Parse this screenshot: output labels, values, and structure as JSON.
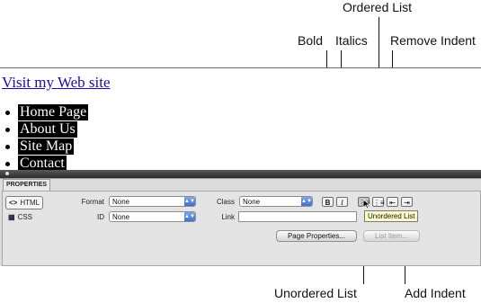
{
  "callouts": {
    "bold": "Bold",
    "italics": "Italics",
    "ordered_list": "Ordered List",
    "remove_indent": "Remove Indent",
    "unordered_list": "Unordered List",
    "add_indent": "Add Indent"
  },
  "page": {
    "link_text": "Visit my Web site",
    "nav_items": [
      "Home Page",
      "About Us",
      "Site Map",
      "Contact"
    ]
  },
  "panel": {
    "tab_label": "PROPERTIES",
    "modes": {
      "html": "HTML",
      "css": "CSS"
    },
    "format_label": "Format",
    "format_value": "None",
    "id_label": "ID",
    "id_value": "None",
    "class_label": "Class",
    "class_value": "None",
    "link_label": "Link",
    "link_value": "",
    "bold_glyph": "B",
    "italic_glyph": "I",
    "page_properties_label": "Page Properties...",
    "list_item_label": "List Item...",
    "tooltip": "Unordered List"
  },
  "icons": [
    "html-icon",
    "css-icon",
    "unordered-list-icon",
    "ordered-list-icon",
    "remove-indent-icon",
    "add-indent-icon",
    "cursor-icon"
  ],
  "colors": {
    "link": "#1a0dab",
    "nav_highlight": "#000000",
    "tooltip_bg": "#ffffcc",
    "select_arrow": "#3e6fd2"
  }
}
